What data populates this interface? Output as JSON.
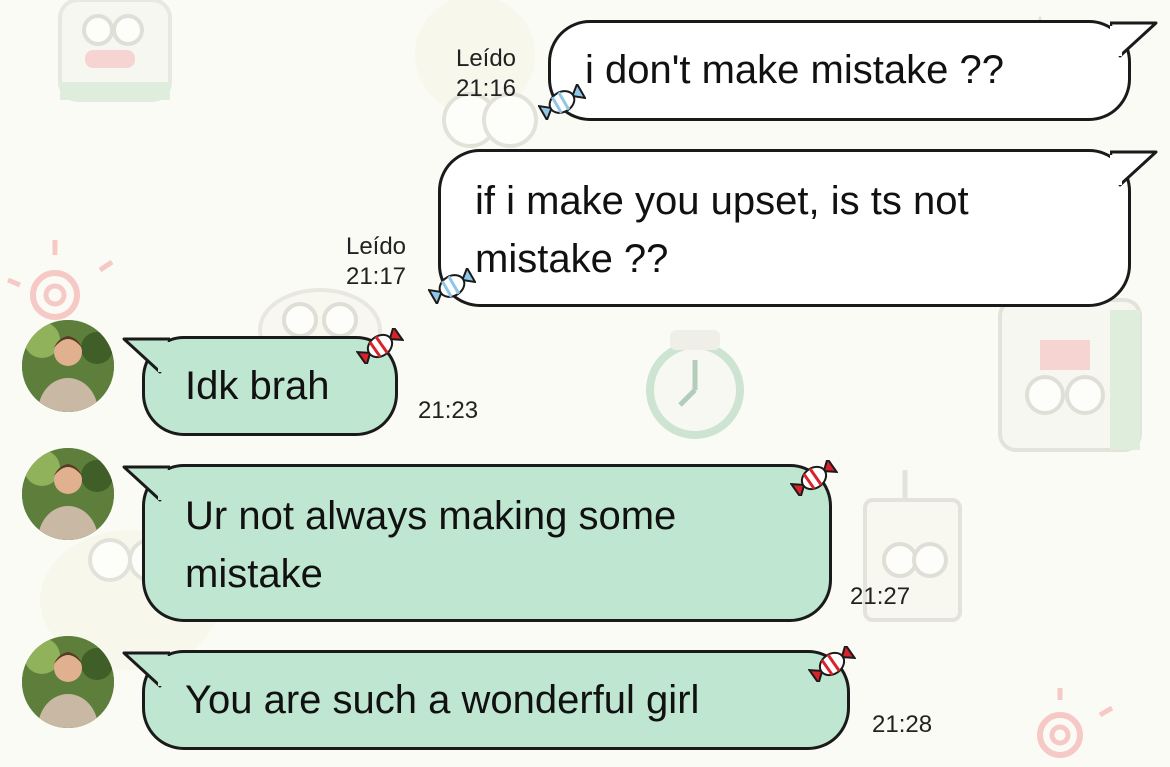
{
  "chat": {
    "messages": [
      {
        "direction": "outgoing",
        "text": "i don't make mistake ??",
        "status": "Leído",
        "time": "21:16"
      },
      {
        "direction": "outgoing",
        "text": "if i make you upset, is ts not\nmistake ??",
        "status": "Leído",
        "time": "21:17"
      },
      {
        "direction": "incoming",
        "text": "Idk brah",
        "time": "21:23"
      },
      {
        "direction": "incoming",
        "text": "Ur not always making some\nmistake",
        "time": "21:27"
      },
      {
        "direction": "incoming",
        "text": "You are such a wonderful girl",
        "time": "21:28"
      }
    ]
  },
  "theme": {
    "outgoing_bubble": "#ffffff",
    "incoming_bubble": "#bfe6d1",
    "border": "#1a1a1a",
    "candy_blue": "#8ec7e8",
    "candy_red": "#d8232a",
    "wallpaper_accent": "#f2a0a0",
    "wallpaper_frog": "#c9e3c9"
  },
  "icons": {
    "outgoing_decoration": "blue-candy-icon",
    "incoming_decoration": "red-candy-icon"
  }
}
